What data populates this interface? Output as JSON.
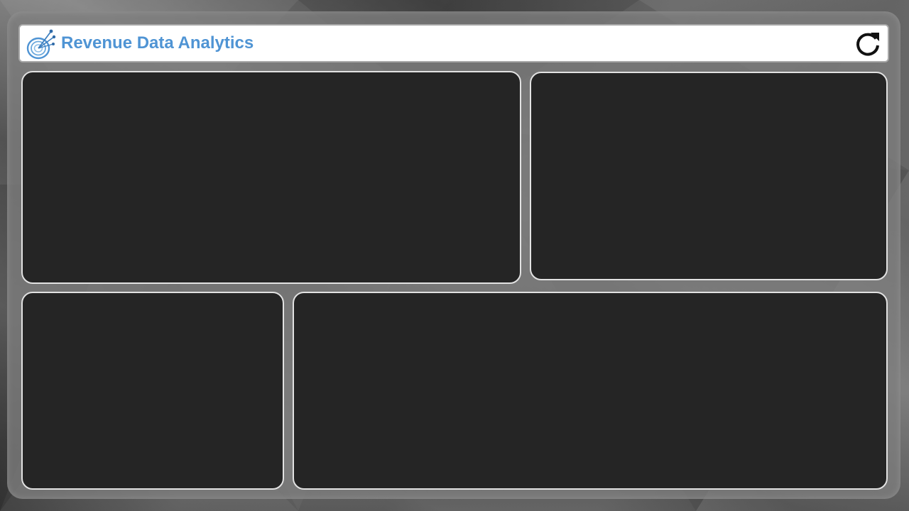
{
  "header": {
    "title": "Revenue Data Analytics",
    "logo_icon": "satellite-dish-icon",
    "refresh_icon": "refresh-icon",
    "title_color": "#4f94d4"
  },
  "panels": [
    {
      "id": "top-left",
      "content": ""
    },
    {
      "id": "top-right",
      "content": ""
    },
    {
      "id": "bottom-left",
      "content": ""
    },
    {
      "id": "bottom-right",
      "content": ""
    }
  ],
  "colors": {
    "panel_background": "#252525",
    "panel_border": "#e2e2e2",
    "header_background": "#ffffff",
    "accent": "#4f94d4"
  }
}
